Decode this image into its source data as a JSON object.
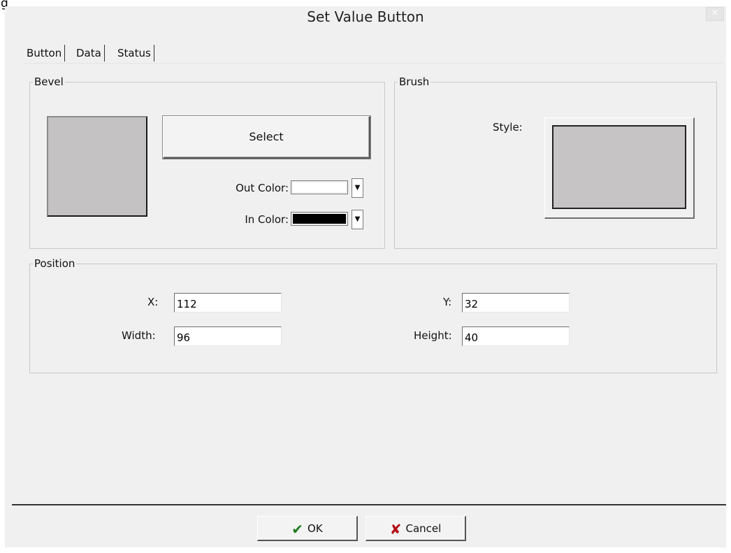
{
  "window": {
    "caption": "g"
  },
  "dialog": {
    "title": "Set Value Button",
    "close_glyph": "×"
  },
  "tabs": [
    {
      "label": "Button",
      "active": true
    },
    {
      "label": "Data",
      "active": false
    },
    {
      "label": "Status",
      "active": false
    }
  ],
  "bevel": {
    "label": "Bevel",
    "swatch_color": "#c4c2c3",
    "select_label": "Select",
    "out_color": {
      "label": "Out Color:",
      "value": "#ffffff"
    },
    "in_color": {
      "label": "In Color:",
      "value": "#000000"
    },
    "dropdown_glyph": "▼"
  },
  "brush": {
    "label": "Brush",
    "style_label": "Style:",
    "style_color": "#c6c4c5"
  },
  "position": {
    "label": "Position",
    "x": {
      "label": "X:",
      "value": "112"
    },
    "y": {
      "label": "Y:",
      "value": "32"
    },
    "width": {
      "label": "Width:",
      "value": "96"
    },
    "height": {
      "label": "Height:",
      "value": "40"
    }
  },
  "buttons": {
    "ok": {
      "label": "OK",
      "icon": "checkmark-icon",
      "glyph": "✔"
    },
    "cancel": {
      "label": "Cancel",
      "icon": "x-icon",
      "glyph": "✘"
    }
  }
}
